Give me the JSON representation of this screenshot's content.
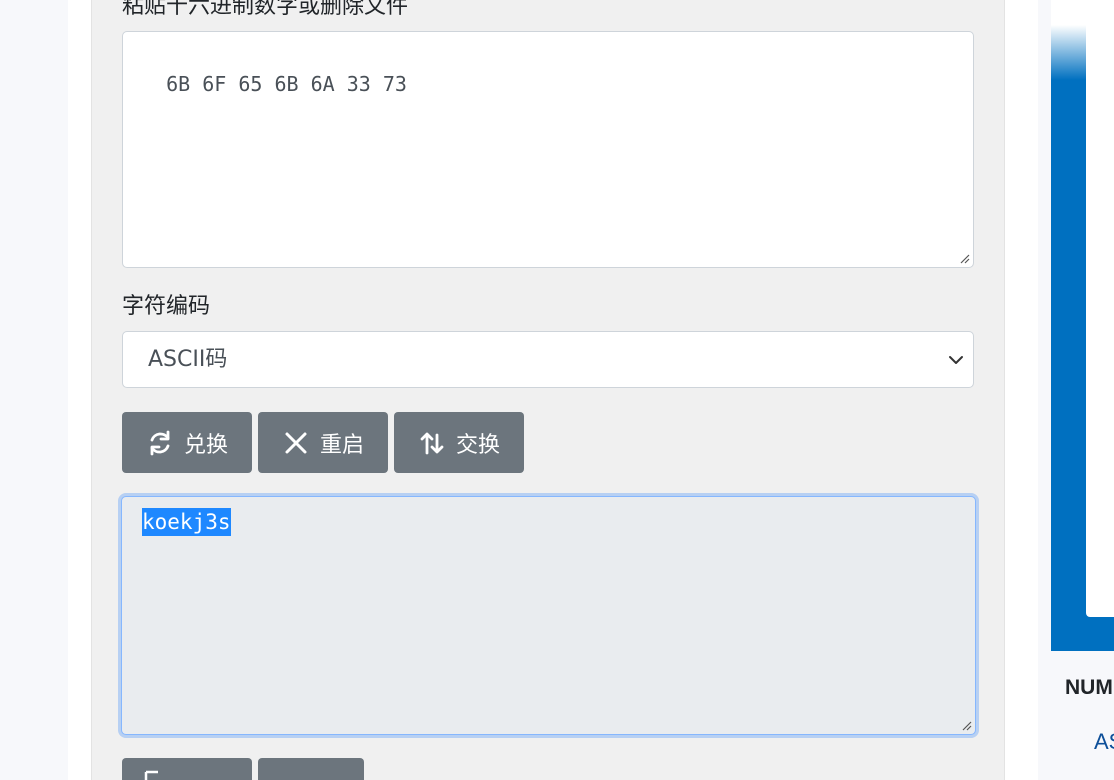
{
  "converter": {
    "hex_input_label": "粘贴十六进制数字或删除文件",
    "hex_input_value": "6B 6F 65 6B 6A 33 73",
    "encoding_label": "字符编码",
    "encoding_selected": "ASCII码",
    "buttons": {
      "convert": "兑换",
      "reset": "重启",
      "swap": "交换"
    },
    "output_value": "koekj3s"
  },
  "sidebar": {
    "heading": "NUM",
    "link": "AS"
  },
  "icons": {
    "convert": "refresh-icon",
    "reset": "close-icon",
    "swap": "swap-icon",
    "select": "chevron-down-icon"
  },
  "colors": {
    "button_bg": "#6c757d",
    "output_bg": "#e9ecef",
    "selection": "#1e88ff",
    "sidebar_blue": "#0070c0"
  }
}
